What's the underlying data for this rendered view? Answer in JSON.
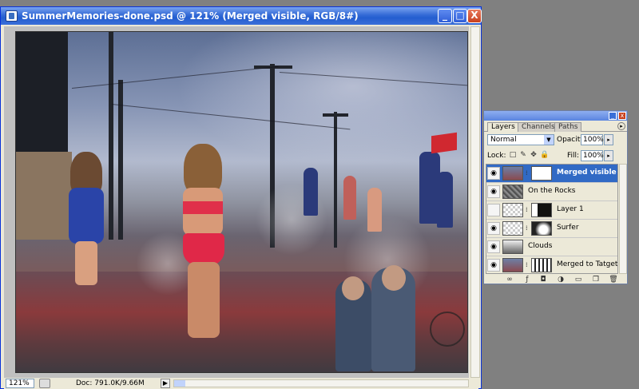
{
  "document": {
    "title": "SummerMemories-done.psd @ 121% (Merged visible, RGB/8#)",
    "buttons": {
      "minimize": "_",
      "maximize": "□",
      "close": "X"
    }
  },
  "statusbar": {
    "zoom": "121%",
    "doc_info": "Doc: 791.0K/9.66M",
    "arrow": "▶"
  },
  "layers_panel": {
    "tabs": [
      "Layers",
      "Channels",
      "Paths"
    ],
    "blend_mode": "Normal",
    "opacity_label": "Opacity:",
    "opacity_value": "100%",
    "lock_label": "Lock:",
    "fill_label": "Fill:",
    "fill_value": "100%",
    "layers": [
      {
        "name": "Merged visible",
        "visible": true,
        "selected": true
      },
      {
        "name": "On the Rocks",
        "visible": true,
        "selected": false
      },
      {
        "name": "Layer 1",
        "visible": false,
        "selected": false
      },
      {
        "name": "Surfer",
        "visible": true,
        "selected": false
      },
      {
        "name": "Clouds",
        "visible": true,
        "selected": false
      },
      {
        "name": "Merged to Tatget",
        "visible": true,
        "selected": false
      }
    ]
  },
  "colors": {
    "selection": "#316ac5",
    "titlebar": "#245ed0",
    "desktop": "#808080"
  }
}
